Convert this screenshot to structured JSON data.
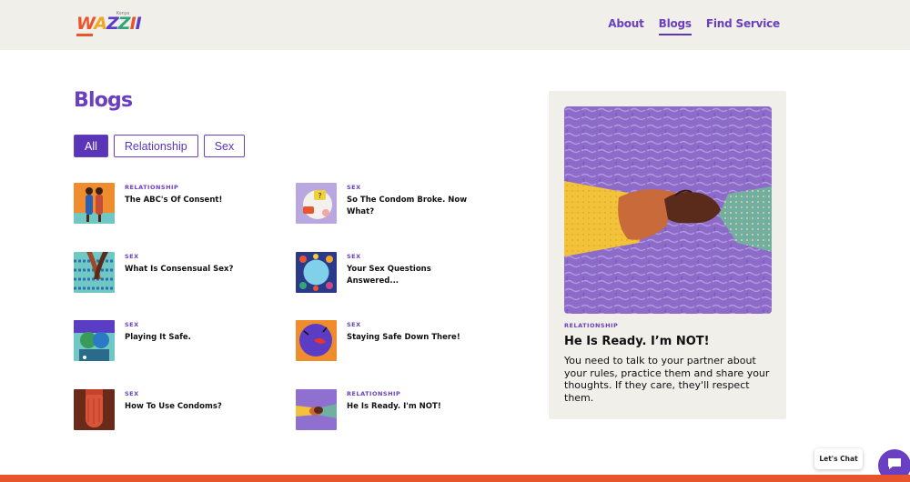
{
  "brand": {
    "logo_letters": [
      "W",
      "A",
      "Z",
      "Z",
      "I",
      "I"
    ],
    "logo_sup": "Kenya"
  },
  "nav": [
    {
      "label": "About",
      "active": false
    },
    {
      "label": "Blogs",
      "active": true
    },
    {
      "label": "Find Service",
      "active": false
    }
  ],
  "page": {
    "title": "Blogs"
  },
  "filters": [
    {
      "label": "All",
      "active": true
    },
    {
      "label": "Relationship",
      "active": false
    },
    {
      "label": "Sex",
      "active": false
    }
  ],
  "blogs": [
    {
      "category": "RELATIONSHIP",
      "title": "The ABC's Of Consent!"
    },
    {
      "category": "SEX",
      "title": "So The Condom Broke. Now What?"
    },
    {
      "category": "SEX",
      "title": "What Is Consensual Sex?"
    },
    {
      "category": "SEX",
      "title": "Your Sex Questions Answered..."
    },
    {
      "category": "SEX",
      "title": "Playing It Safe."
    },
    {
      "category": "SEX",
      "title": "Staying Safe Down There!"
    },
    {
      "category": "SEX",
      "title": "How To Use Condoms?"
    },
    {
      "category": "RELATIONSHIP",
      "title": "He Is Ready. I'm NOT!"
    }
  ],
  "featured": {
    "category": "RELATIONSHIP",
    "title": "He Is Ready. I’m NOT!",
    "description": "You need to talk to your partner about your rules, practice them and share your thoughts. If they care, they'll respect them."
  },
  "chat": {
    "label": "Let's Chat",
    "icon": "chat-icon"
  },
  "colors": {
    "accent": "#6a3fc1",
    "header_bg": "#f0efea",
    "footer": "#e8552c"
  }
}
